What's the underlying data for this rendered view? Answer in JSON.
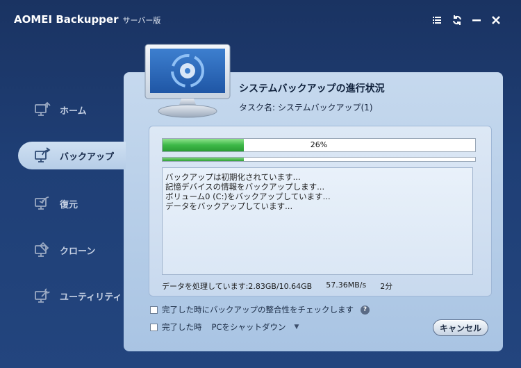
{
  "app": {
    "title": "AOMEI Backupper",
    "edition": "サーバー版"
  },
  "window_controls": [
    "menu-icon",
    "refresh-icon",
    "minimize-icon",
    "close-icon"
  ],
  "sidebar": {
    "items": [
      {
        "label": "ホーム",
        "icon": "home-monitor-icon",
        "active": false
      },
      {
        "label": "バックアップ",
        "icon": "backup-icon",
        "active": true
      },
      {
        "label": "復元",
        "icon": "restore-icon",
        "active": false
      },
      {
        "label": "クローン",
        "icon": "clone-icon",
        "active": false
      },
      {
        "label": "ユーティリティ",
        "icon": "utilities-icon",
        "active": false
      }
    ]
  },
  "main": {
    "heading": "システムバックアップの進行状況",
    "task_name": "タスク名: システムバックアップ(1)",
    "progress": {
      "percent": 26,
      "label": "26%"
    },
    "sub_progress": {
      "percent": 26
    },
    "log_lines": [
      "バックアップは初期化されています...",
      "記憶デバイスの情報をバックアップします...",
      "ボリューム0 (C:)をバックアップしています...",
      "データをバックアップしています..."
    ],
    "stats": {
      "processed": "データを処理しています:2.83GB/10.64GB",
      "speed": "57.36MB/s",
      "time": "2分"
    },
    "options": {
      "verify_label": "完了した時にバックアップの整合性をチェックします",
      "shutdown_label": "完了した時",
      "shutdown_value": "PCをシャットダウン"
    },
    "cancel_label": "キャンセル"
  },
  "colors": {
    "background": "#1f3f76",
    "panel": "#b8cfe9",
    "progress_fill": "#3db847"
  }
}
